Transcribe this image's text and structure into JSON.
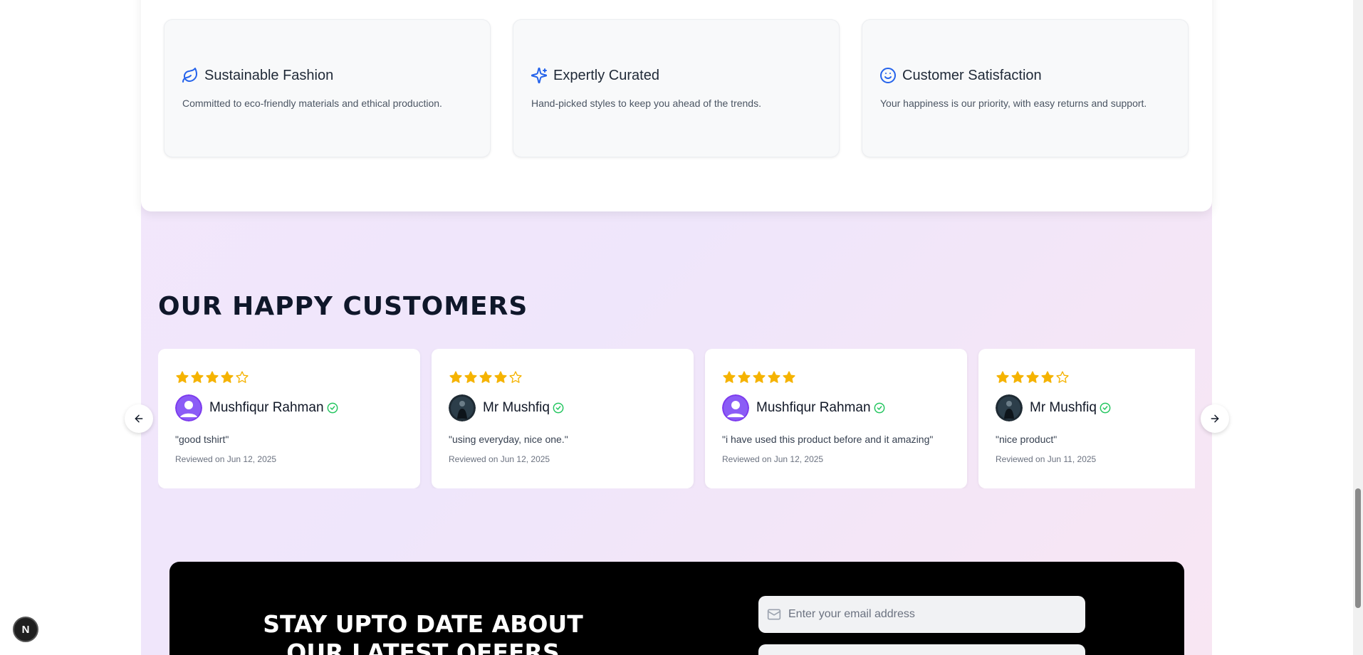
{
  "features": [
    {
      "icon": "leaf-icon",
      "title": "Sustainable Fashion",
      "description": "Committed to eco-friendly materials and ethical production."
    },
    {
      "icon": "sparkles-icon",
      "title": "Expertly Curated",
      "description": "Hand-picked styles to keep you ahead of the trends."
    },
    {
      "icon": "smile-icon",
      "title": "Customer Satisfaction",
      "description": "Your happiness is our priority, with easy returns and support."
    }
  ],
  "testimonials": {
    "title": "OUR HAPPY CUSTOMERS",
    "reviews": [
      {
        "rating": 4,
        "name": "Mushfiqur Rahman",
        "avatar": "default-avatar",
        "text": "\"good tshirt\"",
        "date": "Reviewed on Jun 12, 2025"
      },
      {
        "rating": 4,
        "name": "Mr Mushfiq",
        "avatar": "photo-avatar",
        "text": "\"using everyday, nice one.\"",
        "date": "Reviewed on Jun 12, 2025"
      },
      {
        "rating": 5,
        "name": "Mushfiqur Rahman",
        "avatar": "default-avatar",
        "text": "\"i have used this product before and it amazing\"",
        "date": "Reviewed on Jun 12, 2025"
      },
      {
        "rating": 4,
        "name": "Mr Mushfiq",
        "avatar": "photo-avatar",
        "text": "\"nice product\"",
        "date": "Reviewed on Jun 11, 2025"
      }
    ]
  },
  "newsletter": {
    "heading": "STAY UPTO DATE ABOUT OUR LATEST OFFERS",
    "email_placeholder": "Enter your email address"
  },
  "dev_badge": {
    "label": "N"
  },
  "colors": {
    "accent": "#2563eb",
    "star": "#f5b301",
    "verified": "#22c55e",
    "title": "#0f172a"
  }
}
